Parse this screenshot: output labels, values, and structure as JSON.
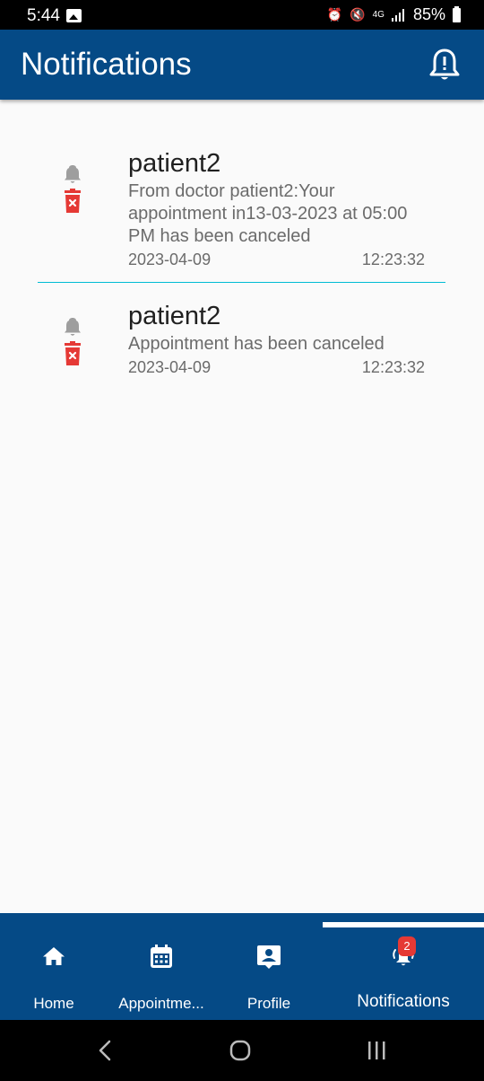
{
  "status_bar": {
    "time": "5:44",
    "network": "4G",
    "battery": "85%",
    "icons": [
      "image-icon",
      "alarm-icon",
      "mute-icon",
      "network-4g-icon",
      "signal-icon",
      "battery-icon"
    ]
  },
  "app_bar": {
    "title": "Notifications",
    "action_icon": "notification-alert-icon"
  },
  "notifications": [
    {
      "title": "patient2",
      "message": "From doctor patient2:Your appointment in13-03-2023 at 05:00 PM has been canceled",
      "date": "2023-04-09",
      "time": "12:23:32"
    },
    {
      "title": "patient2",
      "message": "Appointment has been canceled",
      "date": "2023-04-09",
      "time": "12:23:32"
    }
  ],
  "bottom_nav": {
    "items": [
      {
        "label": "Home",
        "icon": "home-icon"
      },
      {
        "label": "Appointme...",
        "icon": "calendar-icon"
      },
      {
        "label": "Profile",
        "icon": "profile-icon"
      },
      {
        "label": "Notifications",
        "icon": "bell-ringing-icon",
        "badge": "2",
        "active": true
      }
    ]
  },
  "colors": {
    "primary": "#054a86",
    "divider": "#00bcd4",
    "delete": "#e53935",
    "badge": "#e53935",
    "bell": "#9e9e9e"
  }
}
